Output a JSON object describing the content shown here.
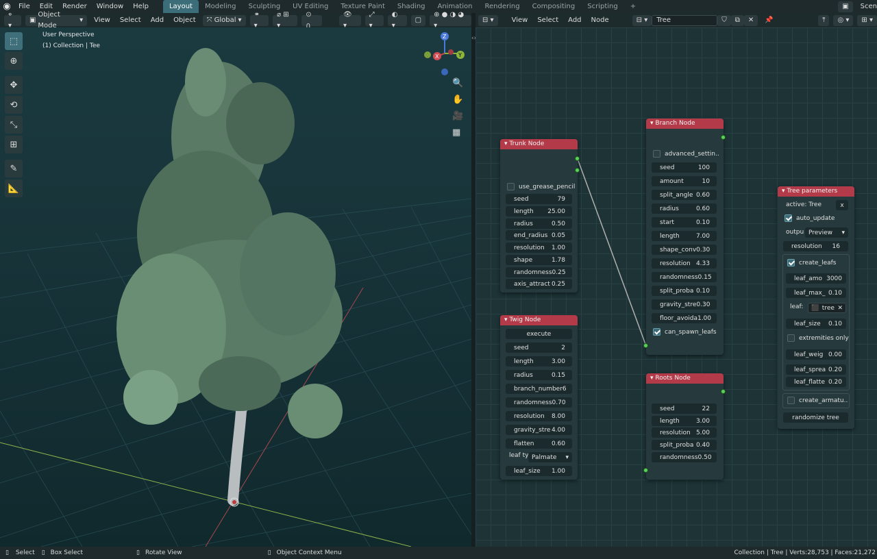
{
  "menubar": {
    "items": [
      "File",
      "Edit",
      "Render",
      "Window",
      "Help"
    ],
    "workspaces": [
      "Layout",
      "Modeling",
      "Sculpting",
      "UV Editing",
      "Texture Paint",
      "Shading",
      "Animation",
      "Rendering",
      "Compositing",
      "Scripting"
    ],
    "active_workspace": "Layout",
    "add_tab": "+",
    "scene": "Scen"
  },
  "viewport_header": {
    "mode": "Object Mode",
    "menus": [
      "View",
      "Select",
      "Add",
      "Object"
    ],
    "transform": "Global"
  },
  "viewport": {
    "perspective": "User Perspective",
    "collection": "(1) Collection | Tee",
    "gizmo": {
      "x": "X",
      "y": "Y",
      "z": "Z"
    }
  },
  "node_header": {
    "menus": [
      "View",
      "Select",
      "Add",
      "Node"
    ],
    "tree_name": "Tree"
  },
  "trunk_node": {
    "title": "Trunk Node",
    "checkbox": "use_grease_pencil",
    "fields": [
      {
        "label": "seed",
        "value": "79"
      },
      {
        "label": "length",
        "value": "25.00"
      },
      {
        "label": "radius",
        "value": "0.50"
      },
      {
        "label": "end_radius",
        "value": "0.05"
      },
      {
        "label": "resolution",
        "value": "1.00"
      },
      {
        "label": "shape",
        "value": "1.78"
      },
      {
        "label": "randomness",
        "value": "0.25"
      },
      {
        "label": "axis_attract",
        "value": "0.25"
      }
    ]
  },
  "twig_node": {
    "title": "Twig Node",
    "execute": "execute",
    "fields": [
      {
        "label": "seed",
        "value": "2"
      },
      {
        "label": "length",
        "value": "3.00"
      },
      {
        "label": "radius",
        "value": "0.15"
      },
      {
        "label": "branch_number",
        "value": "6"
      },
      {
        "label": "randomness",
        "value": "0.70"
      },
      {
        "label": "resolution",
        "value": "8.00"
      },
      {
        "label": "gravity_stre",
        "value": "4.00"
      },
      {
        "label": "flatten",
        "value": "0.60"
      }
    ],
    "leaf_type_label": "leaf ty",
    "leaf_type_value": "Palmate",
    "leaf_size": {
      "label": "leaf_size",
      "value": "1.00"
    }
  },
  "branch_node": {
    "title": "Branch Node",
    "checkbox": "advanced_settin..",
    "fields": [
      {
        "label": "seed",
        "value": "100"
      },
      {
        "label": "amount",
        "value": "10"
      },
      {
        "label": "split_angle",
        "value": "0.60"
      },
      {
        "label": "radius",
        "value": "0.60"
      },
      {
        "label": "start",
        "value": "0.10"
      },
      {
        "label": "length",
        "value": "7.00"
      },
      {
        "label": "shape_conv",
        "value": "0.30"
      },
      {
        "label": "resolution",
        "value": "4.33"
      },
      {
        "label": "randomness",
        "value": "0.15"
      },
      {
        "label": "split_proba",
        "value": "0.10"
      },
      {
        "label": "gravity_stre",
        "value": "0.30"
      },
      {
        "label": "floor_avoida",
        "value": "1.00"
      }
    ],
    "check_spawn": "can_spawn_leafs"
  },
  "roots_node": {
    "title": "Roots Node",
    "fields": [
      {
        "label": "seed",
        "value": "22"
      },
      {
        "label": "length",
        "value": "3.00"
      },
      {
        "label": "resolution",
        "value": "5.00"
      },
      {
        "label": "split_proba",
        "value": "0.40"
      },
      {
        "label": "randomness",
        "value": "0.50"
      }
    ]
  },
  "tree_params": {
    "title": "Tree parameters",
    "active": "active: Tree",
    "x_button": "x",
    "auto_update": "auto_update",
    "output_label": "outpu",
    "output_value": "Preview",
    "resolution": {
      "label": "resolution",
      "value": "16"
    },
    "create_leafs": "create_leafs",
    "leaf_amount": {
      "label": "leaf_amo",
      "value": "3000"
    },
    "leaf_max": {
      "label": "leaf_max_",
      "value": "0.10"
    },
    "leaf_label": "leaf:",
    "leaf_obj": "tree",
    "leaf_size": {
      "label": "leaf_size",
      "value": "0.10"
    },
    "extremities": "extremities only",
    "leaf_weight": {
      "label": "leaf_weig",
      "value": "0.00"
    },
    "leaf_spread": {
      "label": "leaf_sprea",
      "value": "0.20"
    },
    "leaf_flatten": {
      "label": "leaf_flatte",
      "value": "0.20"
    },
    "create_armature": "create_armatu..",
    "randomize": "randomize tree"
  },
  "statusbar": {
    "select": "Select",
    "box_select": "Box Select",
    "rotate": "Rotate View",
    "context": "Object Context Menu",
    "stats": "Collection | Tree | Verts:28,753 | Faces:21,272"
  }
}
